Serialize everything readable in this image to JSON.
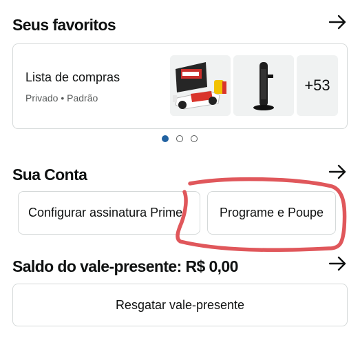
{
  "favorites": {
    "title": "Seus favoritos",
    "list": {
      "name": "Lista de compras",
      "meta": "Privado • Padrão",
      "thumbnails": [
        "lego-race-car-set",
        "black-tower-fan"
      ],
      "more_count": "+53"
    },
    "pagination": {
      "total": 3,
      "active": 1
    }
  },
  "account": {
    "title": "Sua Conta",
    "buttons": [
      {
        "label": "Configurar assinatura Prime"
      },
      {
        "label": "Programe e Poupe"
      }
    ]
  },
  "gift_card": {
    "title": "Saldo do vale-presente: R$ 0,00",
    "redeem_label": "Resgatar vale-presente"
  },
  "colors": {
    "accent_blue": "#2162a1",
    "annotation_red": "#e0575b",
    "border": "#d5d9d9"
  }
}
